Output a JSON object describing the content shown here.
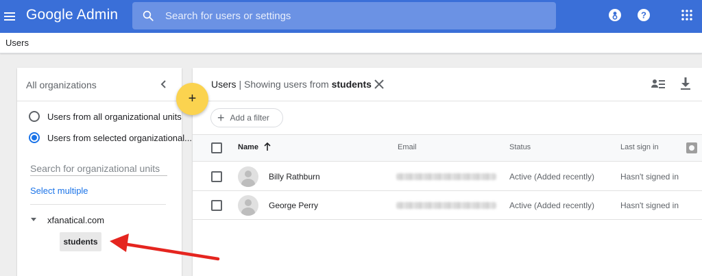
{
  "appbar": {
    "brand": "Google Admin",
    "search_placeholder": "Search for users or settings"
  },
  "breadcrumb": "Users",
  "org_panel": {
    "title": "All organizations",
    "radio_all": "Users from all organizational units",
    "radio_selected": "Users from selected organizational...",
    "search_placeholder": "Search for organizational units",
    "select_multiple": "Select multiple",
    "domain": "xfanatical.com",
    "child_unit": "students"
  },
  "fab_label": "+",
  "main": {
    "title_prefix": "Users",
    "title_middle": " | Showing users from ",
    "title_unit": "students",
    "add_filter": "Add a filter",
    "columns": {
      "name": "Name",
      "email": "Email",
      "status": "Status",
      "last_sign_in": "Last sign in"
    },
    "rows": [
      {
        "name": "Billy Rathburn",
        "status": "Active (Added recently)",
        "last_sign_in": "Hasn't signed in"
      },
      {
        "name": "George Perry",
        "status": "Active (Added recently)",
        "last_sign_in": "Hasn't signed in"
      }
    ]
  },
  "colors": {
    "appbar": "#3a6fd8",
    "fab": "#fbd34f",
    "accent": "#1a73e8",
    "annotation_arrow": "#e5251f"
  }
}
